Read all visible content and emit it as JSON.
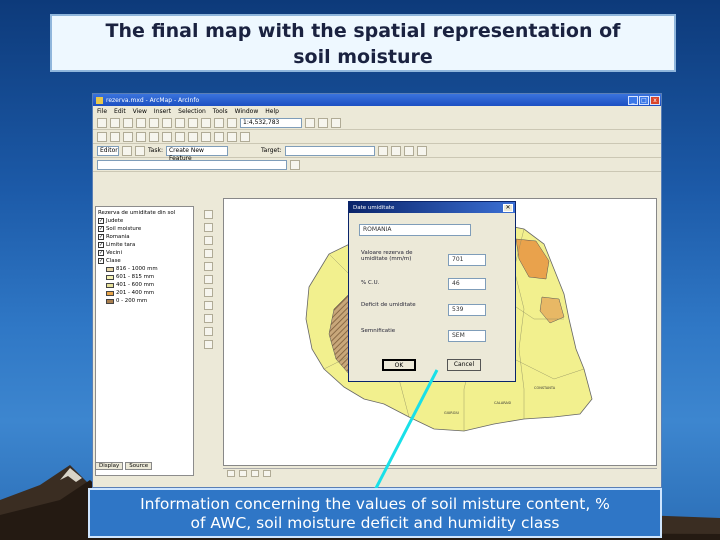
{
  "slide": {
    "title_line1": "The final map with the spatial representation of",
    "title_line2": "soil moisture",
    "caption_line1": "Information concerning the values of soil misture content, %",
    "caption_line2": "of AWC, soil moisture deficit and humidity class"
  },
  "app": {
    "window_title": "rezerva.mxd - ArcMap - ArcInfo",
    "menu": [
      "File",
      "Edit",
      "View",
      "Insert",
      "Selection",
      "Tools",
      "Window",
      "Help"
    ],
    "scale_value": "1:4,532,783",
    "task_label": "Task:",
    "task_value": "Create New Feature",
    "target_label": "Target:",
    "editor_label": "Editor",
    "toc": {
      "root": "Rezerva de umiditate din sol",
      "layers": [
        "Judete",
        "Soil moisture",
        "Romania",
        "Limite tara",
        "Vecini",
        "Clase"
      ],
      "legend_items": [
        "816 - 1000 mm",
        "601 - 815 mm",
        "401 - 600 mm",
        "201 - 400 mm",
        "0 - 200 mm"
      ],
      "footer_tabs": [
        "Display",
        "Source"
      ]
    },
    "colors": {
      "legend": [
        "#e8d7a8",
        "#f4f2b2",
        "#e6e09a",
        "#e8a54a",
        "#a97f4f"
      ],
      "map_fill": "#f2f08e",
      "map_hatch": "#a4845f",
      "map_orange": "#e9a24c"
    }
  },
  "dialog": {
    "title": "Date umiditate",
    "id_value": "ROMANIA",
    "fields": [
      {
        "label": "Valoare rezerva de umiditate (mm/m)",
        "value": "701"
      },
      {
        "label": "% C.U.",
        "value": "46"
      },
      {
        "label": "Deficit de umiditate",
        "value": "539"
      },
      {
        "label": "Semnificatie",
        "value": "SEM"
      }
    ],
    "ok_label": "OK",
    "cancel_label": "Cancel",
    "close_glyph": "✕"
  }
}
